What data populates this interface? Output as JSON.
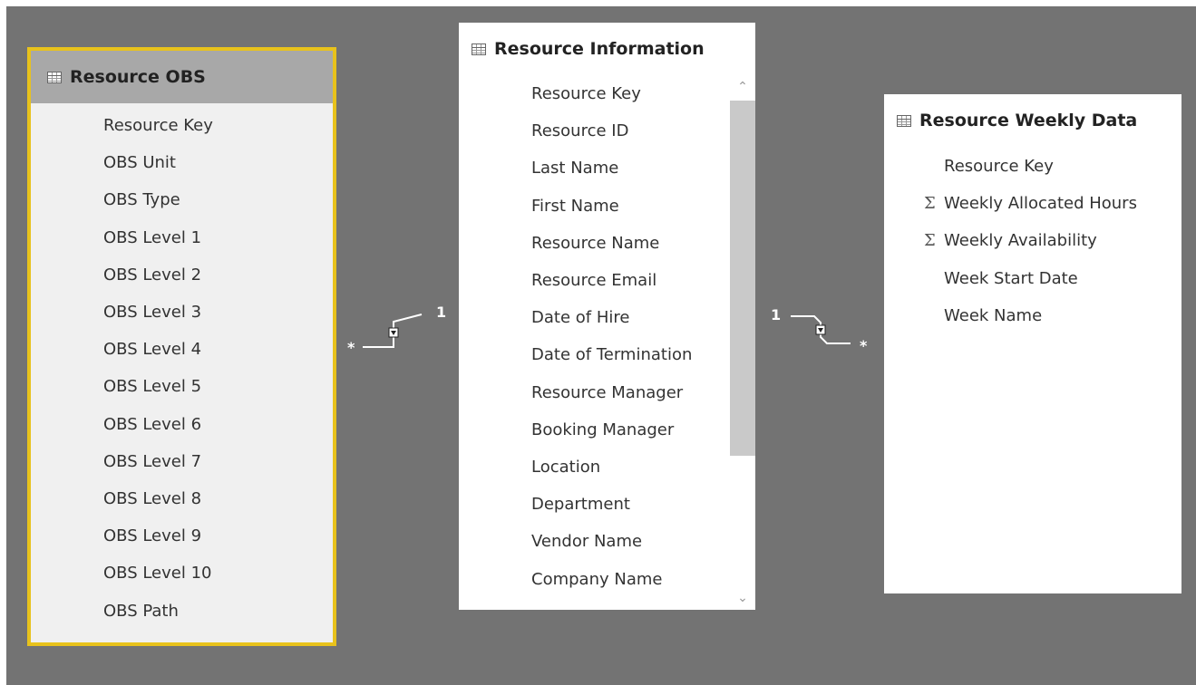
{
  "tables": {
    "obs": {
      "title": "Resource OBS",
      "fields": [
        "Resource Key",
        "OBS Unit",
        "OBS Type",
        "OBS Level 1",
        "OBS Level 2",
        "OBS Level 3",
        "OBS Level 4",
        "OBS Level 5",
        "OBS Level 6",
        "OBS Level 7",
        "OBS Level 8",
        "OBS Level 9",
        "OBS Level 10",
        "OBS Path"
      ]
    },
    "info": {
      "title": "Resource Information",
      "fields": [
        "Resource Key",
        "Resource ID",
        "Last Name",
        "First Name",
        "Resource Name",
        "Resource Email",
        "Date of Hire",
        "Date of Termination",
        "Resource Manager",
        "Booking Manager",
        "Location",
        "Department",
        "Vendor Name",
        "Company Name"
      ]
    },
    "weekly": {
      "title": "Resource Weekly Data",
      "fields": [
        {
          "label": "Resource Key",
          "aggregate": false
        },
        {
          "label": "Weekly Allocated Hours",
          "aggregate": true
        },
        {
          "label": "Weekly Availability",
          "aggregate": true
        },
        {
          "label": "Week Start Date",
          "aggregate": false
        },
        {
          "label": "Week Name",
          "aggregate": false
        }
      ]
    }
  },
  "relationships": {
    "obs_info": {
      "many_label": "*",
      "one_label": "1"
    },
    "info_weekly": {
      "one_label": "1",
      "many_label": "*"
    }
  },
  "colors": {
    "canvas": "#737373",
    "selected_border": "#e8c21c",
    "selected_header": "#a8a8a8"
  },
  "icons": {
    "table": "table-icon",
    "aggregate": "sigma-icon",
    "scroll_up": "chevron-up-icon",
    "scroll_down": "chevron-down-icon",
    "filter": "filter-direction-icon"
  }
}
